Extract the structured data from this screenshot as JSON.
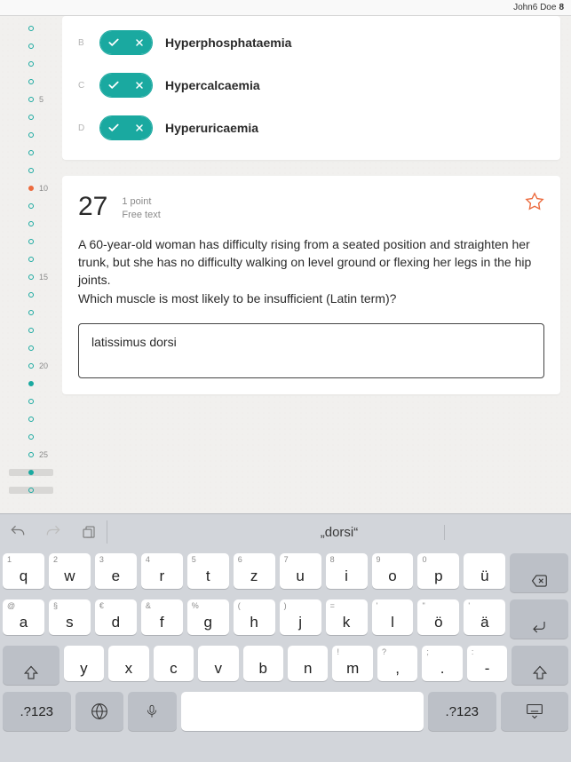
{
  "user": {
    "name": "John6 Doe",
    "badge": "8"
  },
  "progress": {
    "items": [
      {
        "n": 1,
        "label": "",
        "state": "open"
      },
      {
        "n": 2,
        "label": "",
        "state": "open"
      },
      {
        "n": 3,
        "label": "",
        "state": "open"
      },
      {
        "n": 4,
        "label": "",
        "state": "open"
      },
      {
        "n": 5,
        "label": "5",
        "state": "open"
      },
      {
        "n": 6,
        "label": "",
        "state": "open"
      },
      {
        "n": 7,
        "label": "",
        "state": "open"
      },
      {
        "n": 8,
        "label": "",
        "state": "open"
      },
      {
        "n": 9,
        "label": "",
        "state": "open"
      },
      {
        "n": 10,
        "label": "10",
        "state": "orange"
      },
      {
        "n": 11,
        "label": "",
        "state": "open"
      },
      {
        "n": 12,
        "label": "",
        "state": "open"
      },
      {
        "n": 13,
        "label": "",
        "state": "open"
      },
      {
        "n": 14,
        "label": "",
        "state": "open"
      },
      {
        "n": 15,
        "label": "15",
        "state": "open"
      },
      {
        "n": 16,
        "label": "",
        "state": "open"
      },
      {
        "n": 17,
        "label": "",
        "state": "open"
      },
      {
        "n": 18,
        "label": "",
        "state": "open"
      },
      {
        "n": 19,
        "label": "",
        "state": "open"
      },
      {
        "n": 20,
        "label": "20",
        "state": "open"
      },
      {
        "n": 21,
        "label": "",
        "state": "filled"
      },
      {
        "n": 22,
        "label": "",
        "state": "open"
      },
      {
        "n": 23,
        "label": "",
        "state": "open"
      },
      {
        "n": 24,
        "label": "",
        "state": "open"
      },
      {
        "n": 25,
        "label": "25",
        "state": "open"
      },
      {
        "n": 26,
        "label": "",
        "state": "filled",
        "current": true
      },
      {
        "n": 27,
        "label": "",
        "state": "open",
        "current": true
      }
    ]
  },
  "question26": {
    "options": {
      "B": {
        "letter": "B",
        "label": "Hyperphosphataemia"
      },
      "C": {
        "letter": "C",
        "label": "Hypercalcaemia"
      },
      "D": {
        "letter": "D",
        "label": "Hyperuricaemia"
      }
    }
  },
  "question27": {
    "number": "27",
    "points": "1 point",
    "type": "Free text",
    "text": "A 60-year-old woman has difficulty rising from a seated position and straighten her trunk, but she has no difficulty walking on level ground or flexing her legs in the hip joints.\nWhich muscle is most likely to be insufficient (Latin term)?",
    "answer": "latissimus dorsi"
  },
  "keyboard": {
    "suggestion": "„dorsi“",
    "row1": [
      {
        "alt": "1",
        "main": "q"
      },
      {
        "alt": "2",
        "main": "w"
      },
      {
        "alt": "3",
        "main": "e"
      },
      {
        "alt": "4",
        "main": "r"
      },
      {
        "alt": "5",
        "main": "t"
      },
      {
        "alt": "6",
        "main": "z"
      },
      {
        "alt": "7",
        "main": "u"
      },
      {
        "alt": "8",
        "main": "i"
      },
      {
        "alt": "9",
        "main": "o"
      },
      {
        "alt": "0",
        "main": "p"
      },
      {
        "alt": "",
        "main": "ü"
      }
    ],
    "row2": [
      {
        "alt": "@",
        "main": "a"
      },
      {
        "alt": "§",
        "main": "s"
      },
      {
        "alt": "€",
        "main": "d"
      },
      {
        "alt": "&",
        "main": "f"
      },
      {
        "alt": "%",
        "main": "g"
      },
      {
        "alt": "(",
        "main": "h"
      },
      {
        "alt": ")",
        "main": "j"
      },
      {
        "alt": "=",
        "main": "k"
      },
      {
        "alt": "'",
        "main": "l"
      },
      {
        "alt": "\"",
        "main": "ö"
      },
      {
        "alt": "'",
        "main": "ä"
      }
    ],
    "row3": [
      {
        "alt": "",
        "main": "y"
      },
      {
        "alt": "",
        "main": "x"
      },
      {
        "alt": "",
        "main": "c"
      },
      {
        "alt": "",
        "main": "v"
      },
      {
        "alt": "",
        "main": "b"
      },
      {
        "alt": "",
        "main": "n"
      },
      {
        "alt": "!",
        "main": "m"
      },
      {
        "alt": "?",
        "main": ","
      },
      {
        "alt": ";",
        "main": "."
      },
      {
        "alt": ":",
        "main": "-"
      }
    ],
    "symKey": ".?123"
  },
  "icons": {
    "check": "check-icon",
    "cross": "cross-icon",
    "star": "star-icon",
    "undo": "undo-icon",
    "redo": "redo-icon",
    "clipboard": "clipboard-icon",
    "backspace": "backspace-icon",
    "return": "return-icon",
    "shift": "shift-icon",
    "globe": "globe-icon",
    "mic": "mic-icon",
    "hidekb": "hide-keyboard-icon"
  },
  "colors": {
    "teal": "#1aa9a0",
    "orange": "#ec6b3e"
  }
}
